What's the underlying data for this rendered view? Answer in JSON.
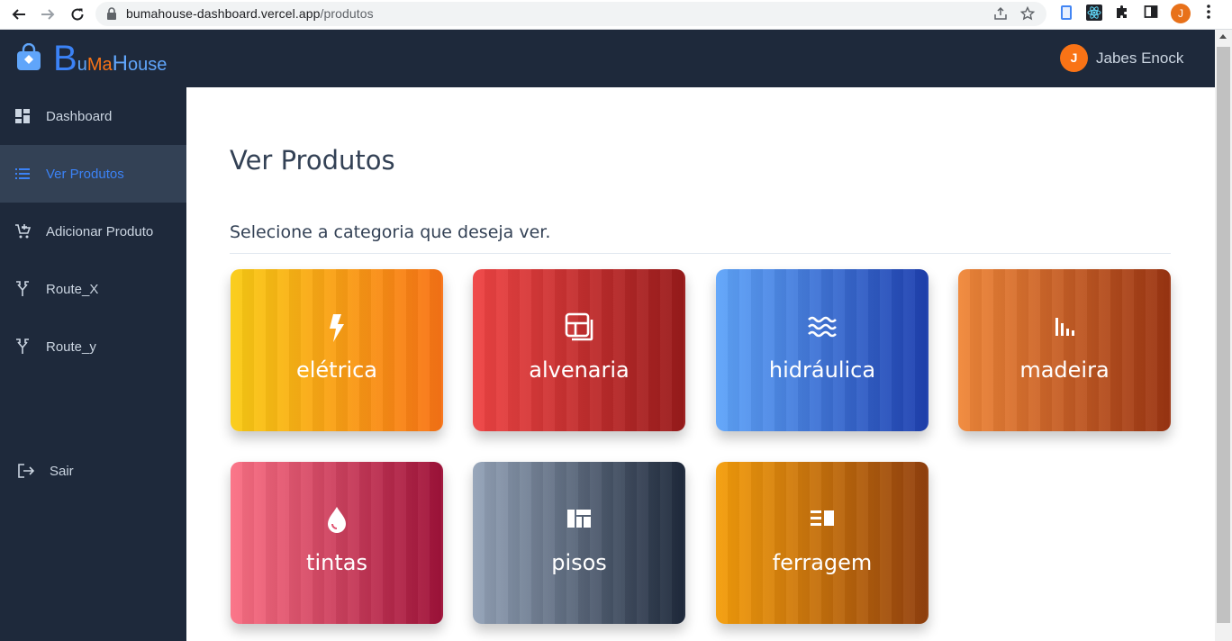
{
  "browser": {
    "url_host": "bumahouse-dashboard.vercel.app",
    "url_path": "/produtos",
    "profile_initial": "J"
  },
  "brand": {
    "b": "B",
    "u": "u",
    "ma": "Ma",
    "h": "H",
    "ouse": "ouse"
  },
  "user": {
    "initial": "J",
    "name": "Jabes Enock"
  },
  "sidebar": {
    "items": [
      {
        "label": "Dashboard",
        "icon": "dashboard-icon"
      },
      {
        "label": "Ver Produtos",
        "icon": "list-icon",
        "active": true
      },
      {
        "label": "Adicionar Produto",
        "icon": "cart-add-icon"
      },
      {
        "label": "Route_X",
        "icon": "route-icon"
      },
      {
        "label": "Route_y",
        "icon": "route-icon"
      },
      {
        "label": "Sair",
        "icon": "logout-icon"
      }
    ]
  },
  "main": {
    "title": "Ver Produtos",
    "subtitle": "Selecione a categoria que deseja ver.",
    "categories": [
      {
        "label": "elétrica",
        "icon": "bolt-icon",
        "color_from": "#facc15",
        "color_to": "#f97316"
      },
      {
        "label": "alvenaria",
        "icon": "layout-icon",
        "color_from": "#ef4444",
        "color_to": "#991b1b"
      },
      {
        "label": "hidráulica",
        "icon": "water-icon",
        "color_from": "#60a5fa",
        "color_to": "#1e40af"
      },
      {
        "label": "madeira",
        "icon": "bars-icon",
        "color_from": "#f0883a",
        "color_to": "#9a3412"
      },
      {
        "label": "tintas",
        "icon": "drop-icon",
        "color_from": "#fb7185",
        "color_to": "#9f1239"
      },
      {
        "label": "pisos",
        "icon": "tiles-icon",
        "color_from": "#94a3b8",
        "color_to": "#1e293b"
      },
      {
        "label": "ferragem",
        "icon": "columns-icon",
        "color_from": "#f59e0b",
        "color_to": "#92400e"
      }
    ]
  },
  "colors": {
    "topbar": "#1e293b",
    "sidebar_active_bg": "#334155",
    "accent": "#3b82f6",
    "avatar": "#f97316"
  }
}
